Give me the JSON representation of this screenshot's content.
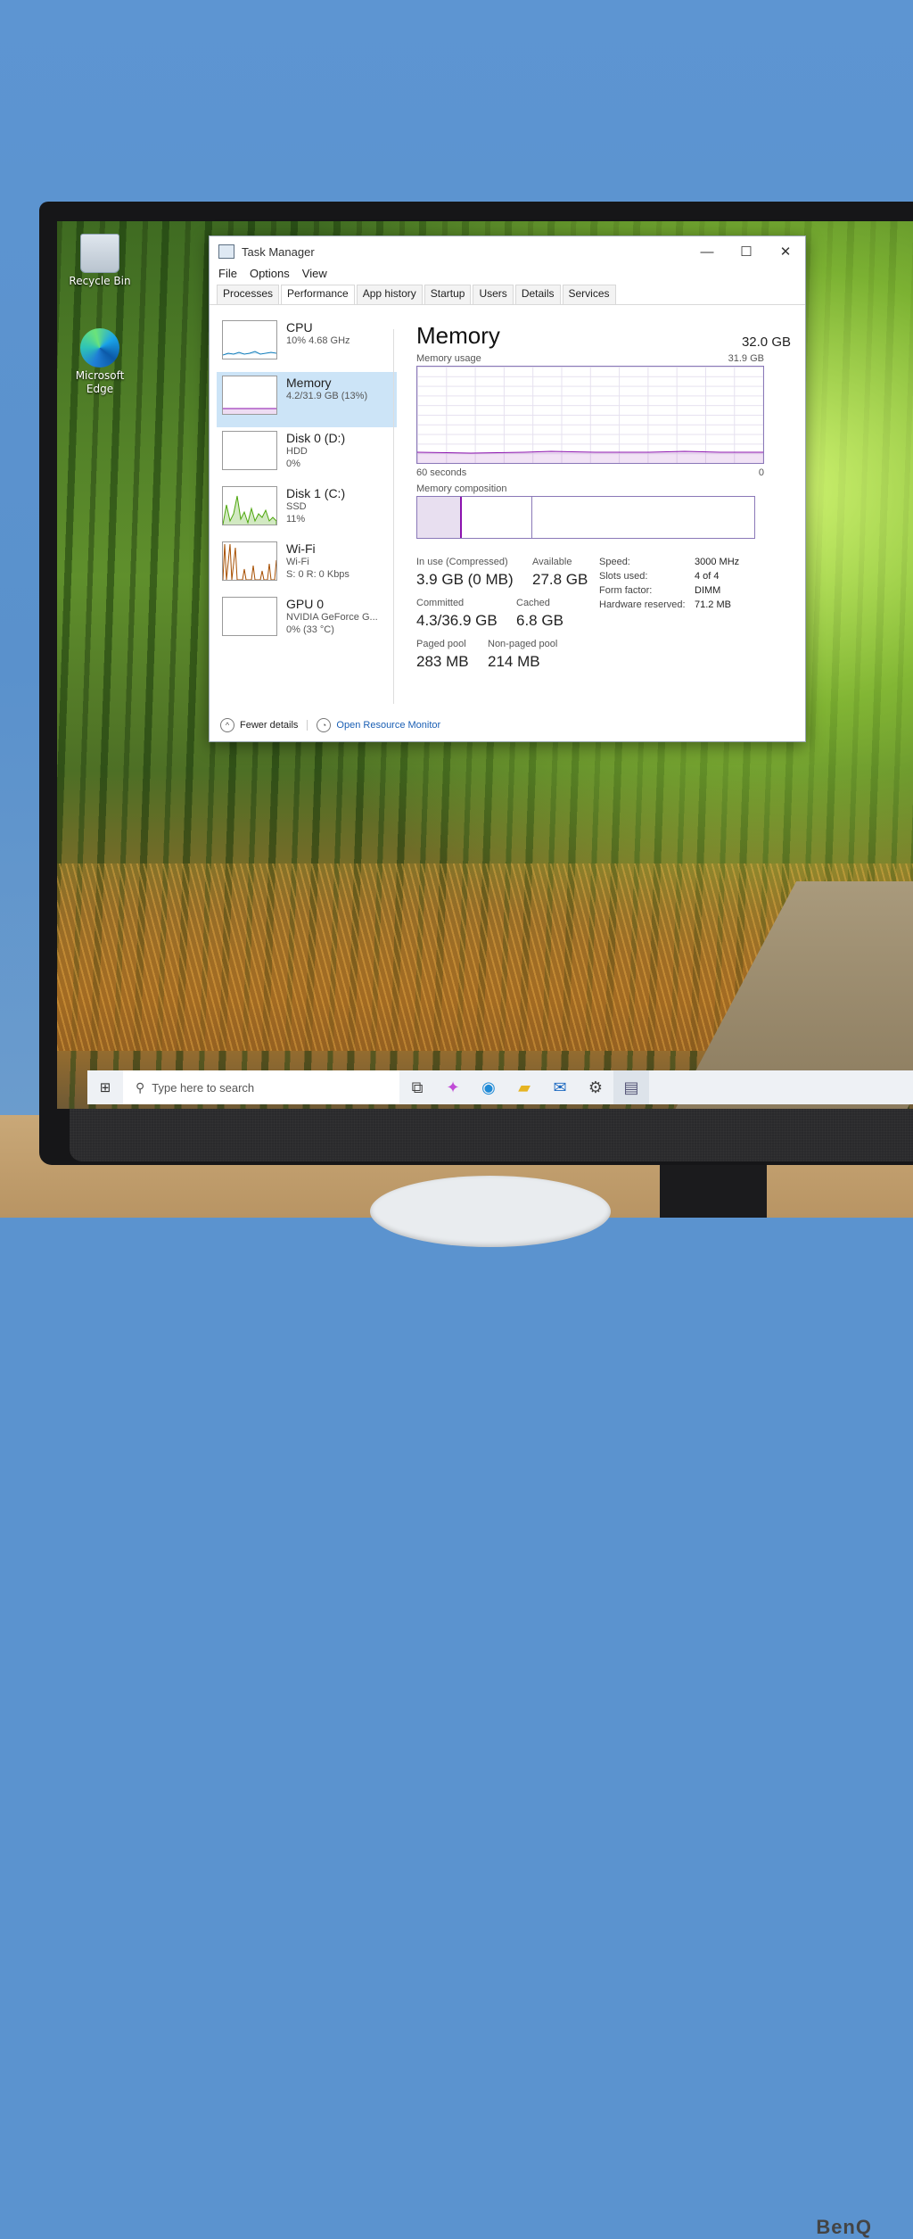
{
  "desktop": {
    "icons": [
      {
        "label": "Recycle Bin",
        "icon": "recycle-bin-icon"
      },
      {
        "label": "Microsoft Edge",
        "icon": "edge-icon"
      }
    ]
  },
  "monitor": {
    "brand": "BenQ"
  },
  "task_manager": {
    "title": "Task Manager",
    "window_buttons": {
      "minimize": "—",
      "maximize": "☐",
      "close": "✕"
    },
    "menu": [
      "File",
      "Options",
      "View"
    ],
    "tabs": [
      "Processes",
      "Performance",
      "App history",
      "Startup",
      "Users",
      "Details",
      "Services"
    ],
    "active_tab": "Performance",
    "resources": [
      {
        "name": "CPU",
        "line1": "10%  4.68 GHz",
        "line2": ""
      },
      {
        "name": "Memory",
        "line1": "4.2/31.9 GB (13%)",
        "line2": ""
      },
      {
        "name": "Disk 0 (D:)",
        "line1": "HDD",
        "line2": "0%"
      },
      {
        "name": "Disk 1 (C:)",
        "line1": "SSD",
        "line2": "11%"
      },
      {
        "name": "Wi-Fi",
        "line1": "Wi-Fi",
        "line2": "S: 0 R: 0 Kbps"
      },
      {
        "name": "GPU 0",
        "line1": "NVIDIA GeForce G...",
        "line2": "0% (33 °C)"
      }
    ],
    "selected_resource": "Memory",
    "memory": {
      "title": "Memory",
      "total": "32.0 GB",
      "usage_label": "Memory usage",
      "usage_max": "31.9 GB",
      "time_label": "60 seconds",
      "zero_label": "0",
      "composition_label": "Memory composition",
      "in_use_label": "In use (Compressed)",
      "in_use_value": "3.9 GB (0 MB)",
      "available_label": "Available",
      "available_value": "27.8 GB",
      "committed_label": "Committed",
      "committed_value": "4.3/36.9 GB",
      "cached_label": "Cached",
      "cached_value": "6.8 GB",
      "paged_label": "Paged pool",
      "paged_value": "283 MB",
      "nonpaged_label": "Non-paged pool",
      "nonpaged_value": "214 MB",
      "specs": [
        {
          "key": "Speed:",
          "value": "3000 MHz"
        },
        {
          "key": "Slots used:",
          "value": "4 of 4"
        },
        {
          "key": "Form factor:",
          "value": "DIMM"
        },
        {
          "key": "Hardware reserved:",
          "value": "71.2 MB"
        }
      ]
    },
    "footer": {
      "fewer_details": "Fewer details",
      "resource_monitor": "Open Resource Monitor"
    }
  },
  "taskbar": {
    "search_placeholder": "Type here to search",
    "icons": [
      "task-view-icon",
      "copilot-icon",
      "edge-icon",
      "file-explorer-icon",
      "mail-icon",
      "settings-icon",
      "task-manager-icon"
    ]
  }
}
